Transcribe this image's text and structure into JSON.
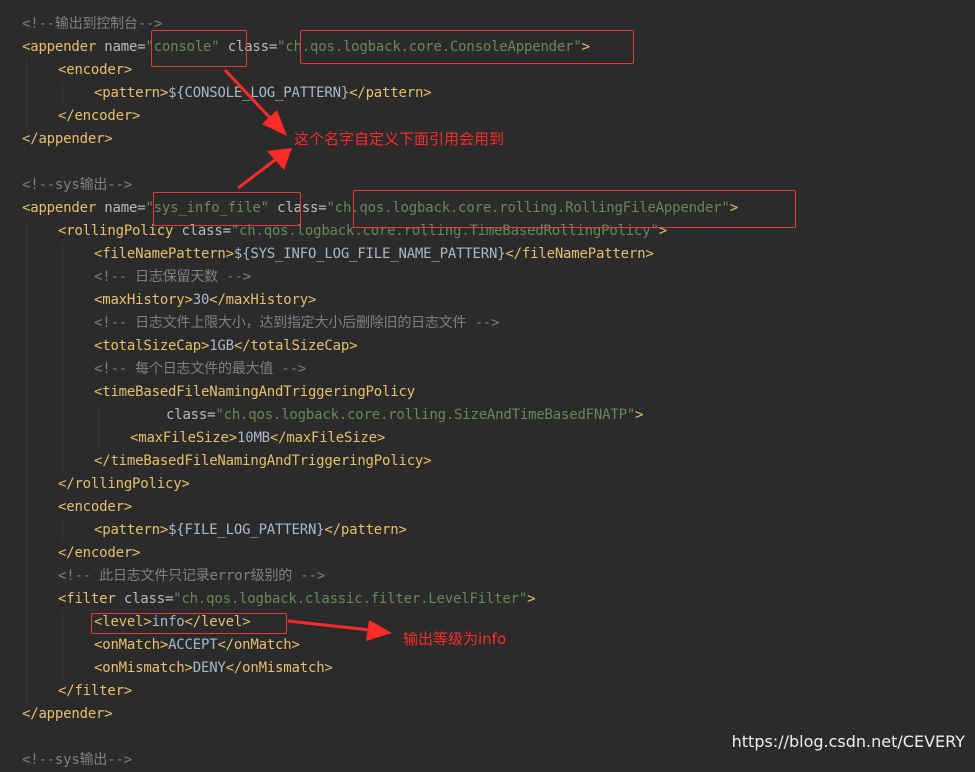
{
  "editor": {
    "lines": [
      {
        "indent": 0,
        "tokens": [
          {
            "k": "c",
            "s": "<!--输出到控制台-->"
          }
        ]
      },
      {
        "indent": 0,
        "tokens": [
          {
            "k": "t",
            "s": "<appender "
          },
          {
            "k": "a",
            "s": "name="
          },
          {
            "k": "v",
            "s": "\"console\""
          },
          {
            "k": "x",
            "s": " "
          },
          {
            "k": "a",
            "s": "class="
          },
          {
            "k": "v",
            "s": "\"ch.qos.logback.core.ConsoleAppender\""
          },
          {
            "k": "t",
            "s": ">"
          }
        ]
      },
      {
        "indent": 1,
        "tokens": [
          {
            "k": "t",
            "s": "<encoder>"
          }
        ]
      },
      {
        "indent": 2,
        "tokens": [
          {
            "k": "t",
            "s": "<pattern>"
          },
          {
            "k": "x",
            "s": "${CONSOLE_LOG_PATTERN}"
          },
          {
            "k": "t",
            "s": "</pattern>"
          }
        ]
      },
      {
        "indent": 1,
        "tokens": [
          {
            "k": "t",
            "s": "</encoder>"
          }
        ]
      },
      {
        "indent": 0,
        "tokens": [
          {
            "k": "t",
            "s": "</appender>"
          }
        ]
      },
      {
        "indent": 0,
        "tokens": []
      },
      {
        "indent": 0,
        "tokens": [
          {
            "k": "c",
            "s": "<!--sys输出-->"
          }
        ]
      },
      {
        "indent": 0,
        "tokens": [
          {
            "k": "t",
            "s": "<appender "
          },
          {
            "k": "a",
            "s": "name="
          },
          {
            "k": "v",
            "s": "\"sys_info_file\""
          },
          {
            "k": "x",
            "s": " "
          },
          {
            "k": "a",
            "s": "class="
          },
          {
            "k": "v",
            "s": "\"ch.qos.logback.core.rolling.RollingFileAppender\""
          },
          {
            "k": "t",
            "s": ">"
          }
        ]
      },
      {
        "indent": 1,
        "tokens": [
          {
            "k": "t",
            "s": "<rollingPolicy "
          },
          {
            "k": "a",
            "s": "class="
          },
          {
            "k": "v",
            "s": "\"ch.qos.logback.core.rolling.TimeBasedRollingPolicy\""
          },
          {
            "k": "t",
            "s": ">"
          }
        ]
      },
      {
        "indent": 2,
        "tokens": [
          {
            "k": "t",
            "s": "<fileNamePattern>"
          },
          {
            "k": "x",
            "s": "${SYS_INFO_LOG_FILE_NAME_PATTERN}"
          },
          {
            "k": "t",
            "s": "</fileNamePattern>"
          }
        ]
      },
      {
        "indent": 2,
        "tokens": [
          {
            "k": "c",
            "s": "<!-- 日志保留天数 -->"
          }
        ]
      },
      {
        "indent": 2,
        "tokens": [
          {
            "k": "t",
            "s": "<maxHistory>"
          },
          {
            "k": "x",
            "s": "30"
          },
          {
            "k": "t",
            "s": "</maxHistory>"
          }
        ]
      },
      {
        "indent": 2,
        "tokens": [
          {
            "k": "c",
            "s": "<!-- 日志文件上限大小，达到指定大小后删除旧的日志文件 -->"
          }
        ]
      },
      {
        "indent": 2,
        "tokens": [
          {
            "k": "t",
            "s": "<totalSizeCap>"
          },
          {
            "k": "x",
            "s": "1GB"
          },
          {
            "k": "t",
            "s": "</totalSizeCap>"
          }
        ]
      },
      {
        "indent": 2,
        "tokens": [
          {
            "k": "c",
            "s": "<!-- 每个日志文件的最大值 -->"
          }
        ]
      },
      {
        "indent": 2,
        "tokens": [
          {
            "k": "t",
            "s": "<timeBasedFileNamingAndTriggeringPolicy"
          }
        ]
      },
      {
        "indent": 4,
        "tokens": [
          {
            "k": "a",
            "s": "class="
          },
          {
            "k": "v",
            "s": "\"ch.qos.logback.core.rolling.SizeAndTimeBasedFNATP\""
          },
          {
            "k": "t",
            "s": ">"
          }
        ]
      },
      {
        "indent": 3,
        "tokens": [
          {
            "k": "t",
            "s": "<maxFileSize>"
          },
          {
            "k": "x",
            "s": "10MB"
          },
          {
            "k": "t",
            "s": "</maxFileSize>"
          }
        ]
      },
      {
        "indent": 2,
        "tokens": [
          {
            "k": "t",
            "s": "</timeBasedFileNamingAndTriggeringPolicy>"
          }
        ]
      },
      {
        "indent": 1,
        "tokens": [
          {
            "k": "t",
            "s": "</rollingPolicy>"
          }
        ]
      },
      {
        "indent": 1,
        "tokens": [
          {
            "k": "t",
            "s": "<encoder>"
          }
        ]
      },
      {
        "indent": 2,
        "tokens": [
          {
            "k": "t",
            "s": "<pattern>"
          },
          {
            "k": "x",
            "s": "${FILE_LOG_PATTERN}"
          },
          {
            "k": "t",
            "s": "</pattern>"
          }
        ]
      },
      {
        "indent": 1,
        "tokens": [
          {
            "k": "t",
            "s": "</encoder>"
          }
        ]
      },
      {
        "indent": 1,
        "tokens": [
          {
            "k": "c",
            "s": "<!-- 此日志文件只记录error级别的 -->"
          }
        ]
      },
      {
        "indent": 1,
        "tokens": [
          {
            "k": "t",
            "s": "<filter "
          },
          {
            "k": "a",
            "s": "class="
          },
          {
            "k": "v",
            "s": "\"ch.qos.logback.classic.filter.LevelFilter\""
          },
          {
            "k": "t",
            "s": ">"
          }
        ]
      },
      {
        "indent": 2,
        "tokens": [
          {
            "k": "t",
            "s": "<level>"
          },
          {
            "k": "x",
            "s": "info"
          },
          {
            "k": "t",
            "s": "</level>"
          }
        ]
      },
      {
        "indent": 2,
        "tokens": [
          {
            "k": "t",
            "s": "<onMatch>"
          },
          {
            "k": "x",
            "s": "ACCEPT"
          },
          {
            "k": "t",
            "s": "</onMatch>"
          }
        ]
      },
      {
        "indent": 2,
        "tokens": [
          {
            "k": "t",
            "s": "<onMismatch>"
          },
          {
            "k": "x",
            "s": "DENY"
          },
          {
            "k": "t",
            "s": "</onMismatch>"
          }
        ]
      },
      {
        "indent": 1,
        "tokens": [
          {
            "k": "t",
            "s": "</filter>"
          }
        ]
      },
      {
        "indent": 0,
        "tokens": [
          {
            "k": "t",
            "s": "</appender>"
          }
        ]
      },
      {
        "indent": 0,
        "tokens": []
      },
      {
        "indent": 0,
        "tokens": [
          {
            "k": "c",
            "s": "<!--sys输出-->"
          }
        ]
      }
    ]
  },
  "annotations": {
    "name_note": "这个名字自定义下面引用会用到",
    "level_note": "输出等级为info"
  },
  "watermark": "https://blog.csdn.net/CEVERY",
  "colors": {
    "background": "#2b2b2b",
    "tag": "#e8bf6a",
    "attribute": "#bababa",
    "string": "#6a8759",
    "comment": "#808080",
    "text": "#a9b7c6",
    "annotation": "#ff2a2a"
  }
}
